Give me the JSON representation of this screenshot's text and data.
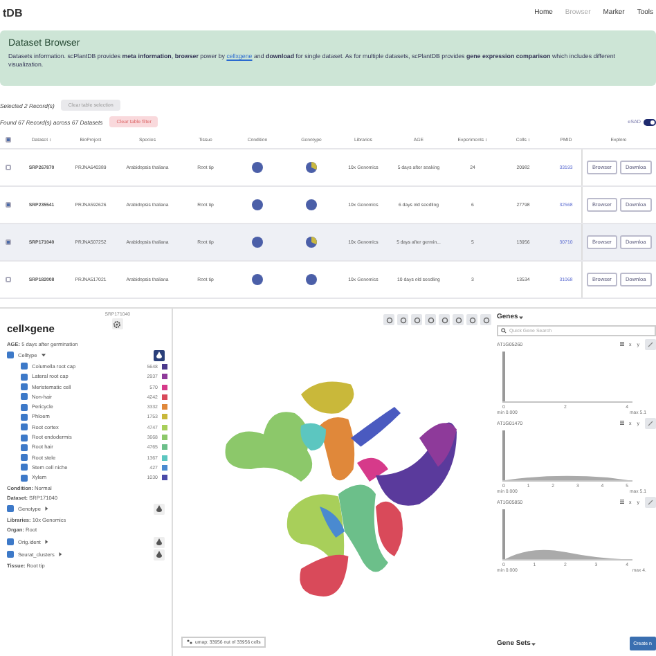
{
  "nav": {
    "logo": "tDB",
    "items": [
      {
        "label": "Home",
        "selected": false
      },
      {
        "label": "Browser",
        "selected": true
      },
      {
        "label": "Marker",
        "selected": false
      },
      {
        "label": "Tools",
        "selected": false
      }
    ]
  },
  "banner": {
    "title": "Dataset Browser",
    "text_before": "Datasets information. scPlantDB provides **meta information**, **browser** power by ",
    "link": "cellxgene",
    "text_after": " and **download** for single dataset. As for multiple datasets, scPlantDB provides **gene expression comparison** which includes different visualization."
  },
  "selection": {
    "summary": "Selected 2 Record(s)",
    "button": "Clear table selection"
  },
  "filter": {
    "summary": "Found 67 Record(s) across 67 Datasets",
    "button": "Clear table filter",
    "toggle_label": "eSAD",
    "toggle_on": true
  },
  "table": {
    "all_checked": true,
    "columns": [
      "Dataset ↕",
      "BioProject",
      "Species",
      "Tissue",
      "Condition",
      "Genotype",
      "Libraries",
      "AGE",
      "Experiments ↕",
      "Cells ↕",
      "PMID",
      "Explore"
    ],
    "rows": [
      {
        "checked": false,
        "highlighted": false,
        "cells": [
          "SRP267870",
          "PRJNA640389",
          "Arabidopsis thaliana",
          "Root tip",
          {
            "kind": "pie",
            "mixed": false
          },
          {
            "kind": "pie",
            "mixed": true
          },
          "10x Genomics",
          "5 days after soaking",
          "24",
          "20982",
          "33193"
        ],
        "actions": [
          "Browser",
          "Downloa"
        ]
      },
      {
        "checked": true,
        "highlighted": false,
        "cells": [
          "SRP235541",
          "PRJNA592626",
          "Arabidopsis thaliana",
          "Root tip",
          {
            "kind": "pie",
            "mixed": false
          },
          {
            "kind": "pie",
            "mixed": false
          },
          "10x Genomics",
          "6 days old seedling",
          "6",
          "27798",
          "32568"
        ],
        "actions": [
          "Browser",
          "Downloa"
        ]
      },
      {
        "checked": true,
        "highlighted": true,
        "cells": [
          "SRP171040",
          "PRJNA507252",
          "Arabidopsis thaliana",
          "Root tip",
          {
            "kind": "pie",
            "mixed": false
          },
          {
            "kind": "pie",
            "mixed": true
          },
          "10x Genomics",
          "5 days after germin...",
          "5",
          "13956",
          "30710"
        ],
        "actions": [
          "Browser",
          "Downloa"
        ]
      },
      {
        "checked": false,
        "highlighted": false,
        "cells": [
          "SRP182008",
          "PRJNA517021",
          "Arabidopsis thaliana",
          "Root tip",
          {
            "kind": "pie",
            "mixed": false
          },
          {
            "kind": "pie",
            "mixed": false
          },
          "10x Genomics",
          "10 days old seedling",
          "3",
          "13534",
          "31068"
        ],
        "actions": [
          "Browser",
          "Downloa"
        ]
      }
    ]
  },
  "cellxgene": {
    "dataset_id": "SRP171040",
    "logo": "cell×gene",
    "entries": [
      {
        "kind": "meta",
        "label": "AGE:",
        "value": "5 days after germination"
      },
      {
        "kind": "category",
        "label": "Celltype",
        "checked": true,
        "expanded": true,
        "color_by": true,
        "children": [
          {
            "label": "Columella root cap",
            "checked": true,
            "count": "5648",
            "color": "#4b3a8c"
          },
          {
            "label": "Lateral root cap",
            "checked": true,
            "count": "2937",
            "color": "#8e3a9a"
          },
          {
            "label": "Meristematic cell",
            "checked": true,
            "count": "570",
            "color": "#d63a8a"
          },
          {
            "label": "Non-hair",
            "checked": true,
            "count": "4242",
            "color": "#d94a5a"
          },
          {
            "label": "Pericycle",
            "checked": true,
            "count": "3332",
            "color": "#e0883a"
          },
          {
            "label": "Phloem",
            "checked": true,
            "count": "1753",
            "color": "#c9b83a"
          },
          {
            "label": "Root cortex",
            "checked": true,
            "count": "4747",
            "color": "#a8cf5a"
          },
          {
            "label": "Root endodermis",
            "checked": true,
            "count": "3668",
            "color": "#8cc86a"
          },
          {
            "label": "Root hair",
            "checked": true,
            "count": "4765",
            "color": "#6cbf8a"
          },
          {
            "label": "Root stele",
            "checked": true,
            "count": "1367",
            "color": "#5cc6c0"
          },
          {
            "label": "Stem cell niche",
            "checked": true,
            "count": "427",
            "color": "#4a8ad0"
          },
          {
            "label": "Xylem",
            "checked": true,
            "count": "1030",
            "color": "#4a4aa8"
          }
        ]
      },
      {
        "kind": "meta",
        "label": "Condition:",
        "value": "Normal"
      },
      {
        "kind": "meta",
        "label": "Dataset:",
        "value": "SRP171040"
      },
      {
        "kind": "category",
        "label": "Genotype",
        "checked": true,
        "expanded": false,
        "color_by": false
      },
      {
        "kind": "meta",
        "label": "Libraries:",
        "value": "10x Genomics"
      },
      {
        "kind": "meta",
        "label": "Organ:",
        "value": "Root"
      },
      {
        "kind": "category",
        "label": "Orig.ident",
        "checked": true,
        "expanded": false,
        "color_by": false
      },
      {
        "kind": "category",
        "label": "Seurat_clusters",
        "checked": true,
        "expanded": false,
        "color_by": false
      },
      {
        "kind": "meta",
        "label": "Tissue:",
        "value": "Root tip"
      }
    ]
  },
  "plot": {
    "footer": "umap: 33956 out of 33956 cells"
  },
  "genes": {
    "title": "Genes",
    "search": {
      "placeholder": "Quick Gene Search"
    },
    "items": [
      {
        "name": "AT1G05260",
        "kind": "spike",
        "axis_buttons": [
          "x",
          "y"
        ],
        "ticks": [
          "0",
          "2",
          "4"
        ],
        "min": "min 0.000",
        "max": "max 5.1"
      },
      {
        "name": "AT1G01470",
        "kind": "spike_low_hump",
        "axis_buttons": [
          "x",
          "y"
        ],
        "ticks": [
          "0",
          "1",
          "2",
          "3",
          "4",
          "5"
        ],
        "min": "min 0.000",
        "max": "max 5.1"
      },
      {
        "name": "AT1G05850",
        "kind": "spike_hump",
        "axis_buttons": [
          "x",
          "y"
        ],
        "ticks": [
          "0",
          "1",
          "2",
          "3",
          "4"
        ],
        "min": "min 0.000",
        "max": "max 4."
      }
    ]
  },
  "gene_sets": {
    "title": "Gene Sets",
    "button": "Create n"
  }
}
